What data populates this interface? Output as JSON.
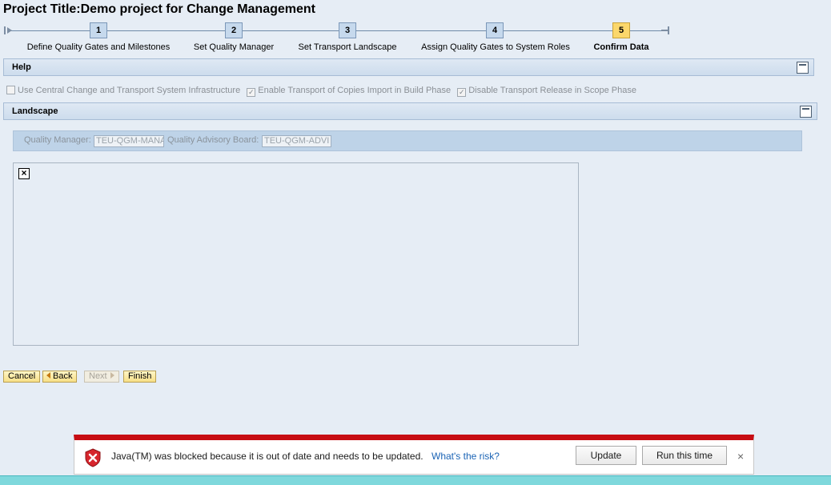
{
  "page": {
    "title": "Project Title:Demo project for Change Management"
  },
  "roadmap": {
    "steps": [
      {
        "number": "1",
        "label": "Define Quality Gates and Milestones"
      },
      {
        "number": "2",
        "label": "Set Quality Manager"
      },
      {
        "number": "3",
        "label": "Set Transport Landscape"
      },
      {
        "number": "4",
        "label": "Assign Quality Gates to System Roles"
      },
      {
        "number": "5",
        "label": "Confirm Data",
        "active": true
      }
    ]
  },
  "help": {
    "title": "Help"
  },
  "options": [
    {
      "label": "Use Central Change and Transport System Infrastructure",
      "checked": false
    },
    {
      "label": "Enable Transport of Copies Import in Build Phase",
      "checked": true
    },
    {
      "label": "Disable Transport Release in Scope Phase",
      "checked": true
    }
  ],
  "landscape": {
    "title": "Landscape",
    "quality_manager_label": "Quality Manager:",
    "quality_manager_value": "TEU-QGM-MANA",
    "advisory_board_label": "Quality Advisory Board:",
    "advisory_board_value": "TEU-QGM-ADVI"
  },
  "buttons": {
    "cancel": "Cancel",
    "back": "Back",
    "next": "Next",
    "finish": "Finish"
  },
  "java_bar": {
    "message": "Java(TM) was blocked because it is out of date and needs to be updated.",
    "link": "What's the risk?",
    "update": "Update",
    "run": "Run this time",
    "close": "×"
  },
  "colors": {
    "active_step": "#fbd76b",
    "alert_red": "#c70d13",
    "link_blue": "#1a63b5"
  }
}
